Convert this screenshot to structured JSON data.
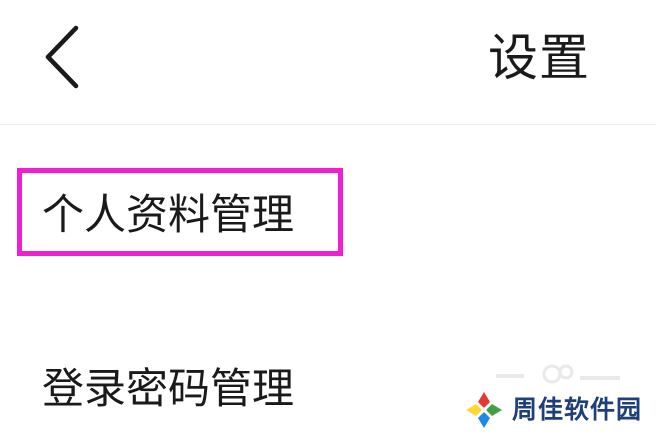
{
  "header": {
    "title": "设置",
    "back_icon": "chevron-left-icon"
  },
  "menu": {
    "items": [
      {
        "label": "个人资料管理",
        "highlighted": true
      },
      {
        "label": "登录密码管理",
        "highlighted": false
      }
    ]
  },
  "colors": {
    "highlight": "#f01fd0",
    "text": "#1a1a1a",
    "divider": "#ececec",
    "watermark_text": "#1f3f7a"
  },
  "watermark": {
    "text": "周佳软件园"
  }
}
